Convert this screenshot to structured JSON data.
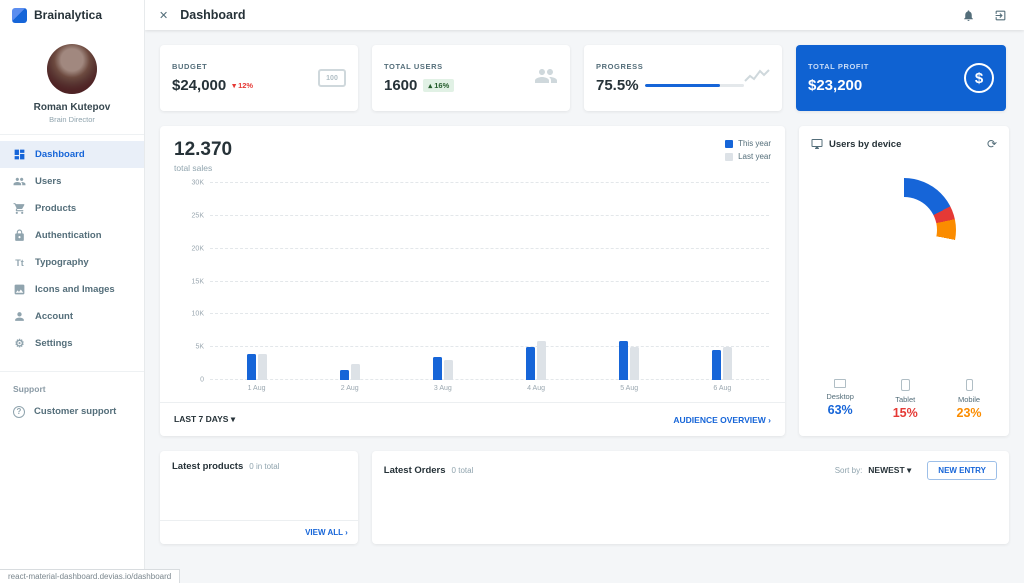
{
  "app": {
    "brand": "Brainalytica",
    "primary_color": "#1665d8"
  },
  "topbar": {
    "title": "Dashboard",
    "close_icon": "✕"
  },
  "sidebar": {
    "user": {
      "name": "Roman Kutepov",
      "role": "Brain Director"
    },
    "items": [
      {
        "label": "Dashboard",
        "icon": "dashboard-icon",
        "active": true
      },
      {
        "label": "Users",
        "icon": "users-icon"
      },
      {
        "label": "Products",
        "icon": "cart-icon"
      },
      {
        "label": "Authentication",
        "icon": "lock-icon"
      },
      {
        "label": "Typography",
        "icon": "typography-icon",
        "glyph": "Tt"
      },
      {
        "label": "Icons and Images",
        "icon": "image-icon"
      },
      {
        "label": "Account",
        "icon": "person-icon"
      },
      {
        "label": "Settings",
        "icon": "gear-icon",
        "glyph": "⚙"
      }
    ],
    "section_label": "Support",
    "support_item": {
      "label": "Customer support",
      "icon": "help-icon",
      "glyph": "?"
    }
  },
  "stats": {
    "budget": {
      "label": "BUDGET",
      "value": "$24,000",
      "delta_arrow": "▾",
      "delta": "12%",
      "delta_color": "#e53935",
      "icon": "banknote-icon",
      "icon_text": "100"
    },
    "users": {
      "label": "TOTAL USERS",
      "value": "1600",
      "delta_arrow": "▴",
      "delta": "16%",
      "delta_color": "#265e2e",
      "icon": "people-icon"
    },
    "progress": {
      "label": "PROGRESS",
      "value": "75.5%",
      "percent": 75.5,
      "bar_color": "#1665d8",
      "icon": "sparkline-icon"
    },
    "profit": {
      "label": "TOTAL PROFIT",
      "value": "$23,200",
      "bg_color": "#0f62d2",
      "icon": "dollar-icon",
      "icon_text": "$"
    }
  },
  "sales": {
    "value": "12.370",
    "subtitle": "total sales",
    "range_label": "LAST 7 DAYS ▾",
    "overview_label": "AUDIENCE OVERVIEW ›"
  },
  "devices": {
    "title": "Users by device",
    "refresh_icon": "⟳",
    "items": [
      {
        "label": "Desktop",
        "value": "63%",
        "color": "#1665d8"
      },
      {
        "label": "Tablet",
        "value": "15%",
        "color": "#e53935"
      },
      {
        "label": "Mobile",
        "value": "23%",
        "color": "#fb8c00"
      }
    ]
  },
  "latest_products": {
    "title": "Latest products",
    "count": "0 in total",
    "view_all": "VIEW ALL ›"
  },
  "latest_orders": {
    "title": "Latest Orders",
    "count": "0 total",
    "sort_label": "Sort by:",
    "sort_value": "NEWEST ▾",
    "new_entry_label": "NEW ENTRY"
  },
  "statusbar": {
    "text": "react-material-dashboard.devias.io/dashboard"
  },
  "chart_data": [
    {
      "type": "bar",
      "title": "12.370 total sales",
      "categories": [
        "1 Aug",
        "2 Aug",
        "3 Aug",
        "4 Aug",
        "5 Aug",
        "6 Aug"
      ],
      "series": [
        {
          "name": "This year",
          "color": "#1665d8",
          "values": [
            4000,
            1500,
            3500,
            5000,
            6000,
            4500
          ]
        },
        {
          "name": "Last year",
          "color": "#dde2e7",
          "values": [
            4000,
            2500,
            3000,
            6000,
            5000,
            5000
          ]
        }
      ],
      "xlabel": "",
      "ylabel": "",
      "ylim": [
        0,
        30000
      ],
      "yticks": [
        "0",
        "5K",
        "10K",
        "15K",
        "20K",
        "25K",
        "30K"
      ],
      "grid": true,
      "legend_position": "top-right"
    },
    {
      "type": "pie",
      "title": "Users by device",
      "labels": [
        "Desktop",
        "Tablet",
        "Mobile"
      ],
      "values": [
        63,
        15,
        23
      ],
      "colors": [
        "#1665d8",
        "#e53935",
        "#fb8c00"
      ],
      "donut": true
    }
  ]
}
